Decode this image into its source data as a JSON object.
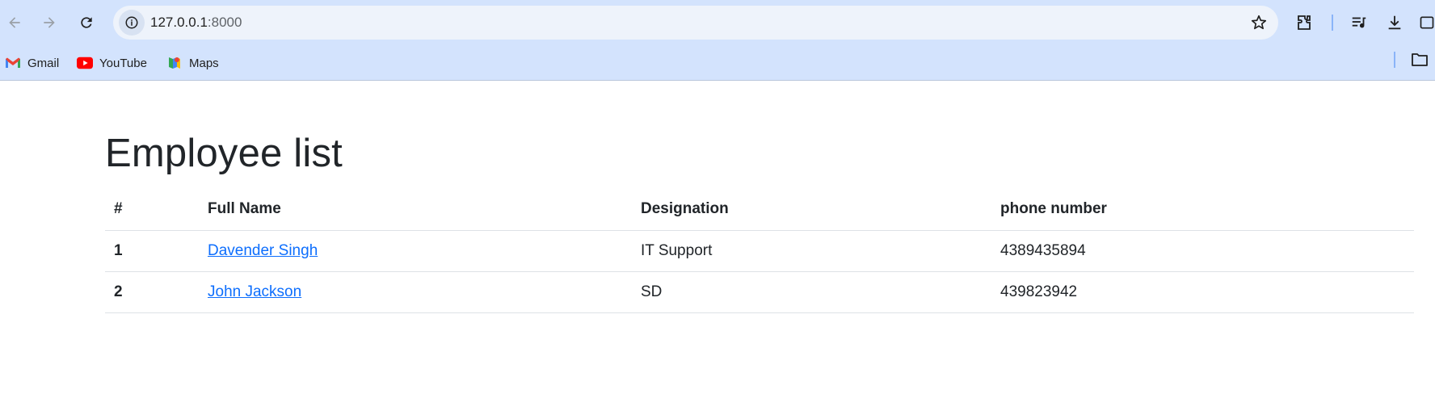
{
  "browser": {
    "url_host": "127.0.0.1",
    "url_port": ":8000",
    "bookmarks": [
      {
        "label": "Gmail",
        "icon": "gmail-icon"
      },
      {
        "label": "YouTube",
        "icon": "youtube-icon"
      },
      {
        "label": "Maps",
        "icon": "maps-icon"
      }
    ]
  },
  "page": {
    "title": "Employee list",
    "table": {
      "headers": [
        "#",
        "Full Name",
        "Designation",
        "phone number"
      ],
      "rows": [
        {
          "num": "1",
          "name": "Davender Singh",
          "designation": "IT Support",
          "phone": "4389435894"
        },
        {
          "num": "2",
          "name": "John Jackson",
          "designation": "SD",
          "phone": "439823942"
        }
      ]
    }
  },
  "colors": {
    "chrome_bg": "#d3e3fd",
    "link": "#0d6efd",
    "text": "#212529"
  }
}
